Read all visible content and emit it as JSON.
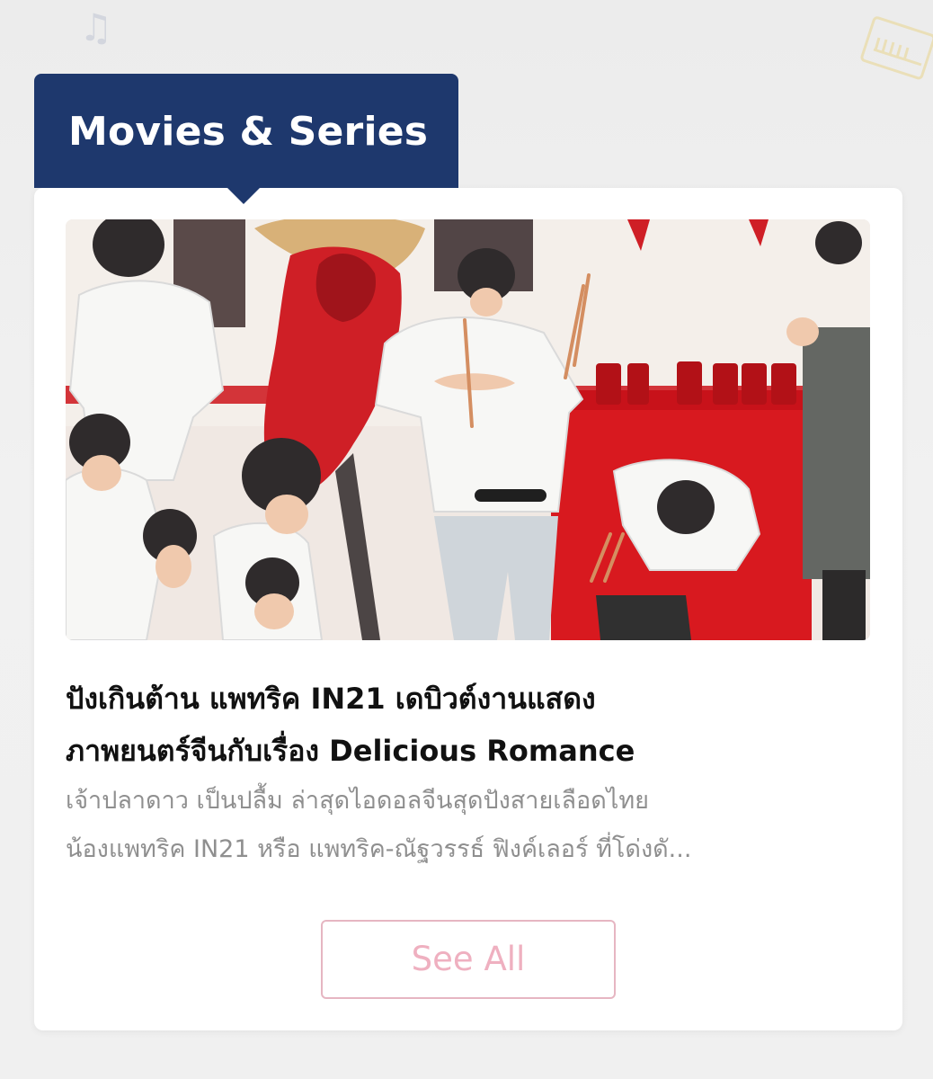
{
  "section": {
    "title": "Movies & Series"
  },
  "article": {
    "title_lines": [
      "ปังเกินต้าน แพทริค IN21 เดบิวต์งานแสดง",
      "ภาพยนตร์จีนกับเรื่อง Delicious Romance"
    ],
    "excerpt_lines": [
      "เจ้าปลาดาว เป็นปลื้ม ล่าสุดไอดอลจีนสุดปังสายเลือดไทย",
      "น้องแพทริค IN21 หรือ แพทริค-ณัฐวรรธ์ ฟิงค์เลอร์ ที่โด่งดั..."
    ]
  },
  "actions": {
    "see_all_label": "See All"
  },
  "colors": {
    "tab_background": "#1e386d",
    "title_text": "#111111",
    "excerpt_text": "#8f8f8f",
    "button_border": "#e6b6c2",
    "button_text": "#efb0c0"
  },
  "icons": {
    "background_note": "music-note-icon",
    "background_ticket": "ticket-icon"
  }
}
